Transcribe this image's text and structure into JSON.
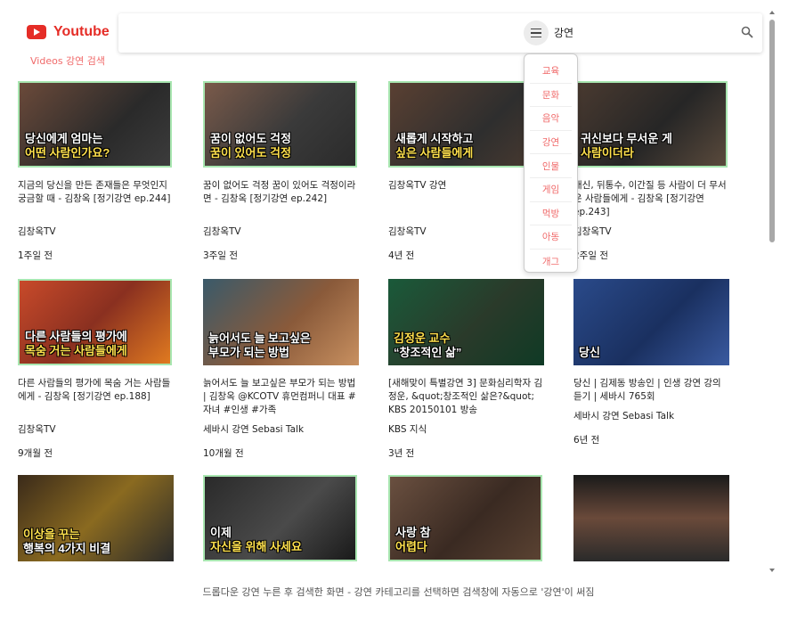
{
  "app": {
    "logo_text": "Youtube",
    "subtitle": "Videos 강연 검색"
  },
  "search": {
    "value": "강연"
  },
  "dropdown": {
    "items": [
      "교육",
      "문화",
      "음악",
      "강연",
      "인물",
      "게임",
      "먹방",
      "아동",
      "개그"
    ]
  },
  "videos": [
    {
      "title": "지금의 당신을 만든 존재들은 무엇인지 궁금할 때 - 김창옥 [정기강연 ep.244]",
      "channel": "김창옥TV",
      "time": "1주일 전",
      "thumb_text_1": "당신에게 엄마는",
      "thumb_text_2": "어떤 사람인가요?"
    },
    {
      "title": "꿈이 없어도 걱정 꿈이 있어도 걱정이라면 - 김창옥 [정기강연 ep.242]",
      "channel": "김창옥TV",
      "time": "3주일 전",
      "thumb_text_1": "꿈이 없어도 걱정",
      "thumb_text_2": "꿈이 있어도 걱정"
    },
    {
      "title": "김창옥TV 강연",
      "channel": "김창옥TV",
      "time": "4년 전",
      "thumb_text_1": "새롭게 시작하고",
      "thumb_text_2": "싶은 사람들에게"
    },
    {
      "title": "배신, 뒤통수, 이간질 등 사람이 더 무서운 사람들에게 - 김창옥 [정기강연 ep.243]",
      "channel": "김창옥TV",
      "time": "2주일 전",
      "thumb_text_1": "귀신보다 무서운 게",
      "thumb_text_2": "사람이더라"
    },
    {
      "title": "다른 사람들의 평가에 목숨 거는 사람들에게 - 김창옥 [정기강연 ep.188]",
      "channel": "김창옥TV",
      "time": "9개월 전",
      "thumb_text_1": "다른 사람들의 평가에",
      "thumb_text_2": "목숨 거는 사람들에게"
    },
    {
      "title": "늙어서도 늘 보고싶은 부모가 되는 방법 | 김창옥 @KCOTV 휴먼컴퍼니 대표 #자녀 #인생 #가족",
      "channel": "세바시 강연 Sebasi Talk",
      "time": "10개월 전",
      "thumb_text_1": "늙어서도 늘 보고싶은",
      "thumb_text_2": "부모가 되는 방법"
    },
    {
      "title": "[새해맞이 특별강연 3] 문화심리학자 김정운, &quot;창조적인 삶은?&quot; KBS 20150101 방송",
      "channel": "KBS 지식",
      "time": "3년 전",
      "thumb_text_1": "김정운 교수",
      "thumb_text_2": "“창조적인 삶”"
    },
    {
      "title": "당신 | 김제동 방송인 | 인생 강연 강의 듣기 | 세바시 765회",
      "channel": "세바시 강연 Sebasi Talk",
      "time": "6년 전",
      "thumb_text_1": "",
      "thumb_text_2": "당신"
    },
    {
      "title": "",
      "channel": "",
      "time": "",
      "thumb_text_1": "이상을 꾸는",
      "thumb_text_2": "행복의 4가지 비결"
    },
    {
      "title": "",
      "channel": "",
      "time": "",
      "thumb_text_1": "이제",
      "thumb_text_2": "자신을 위해 사세요"
    },
    {
      "title": "",
      "channel": "",
      "time": "",
      "thumb_text_1": "사랑 참",
      "thumb_text_2": "어렵다"
    },
    {
      "title": "",
      "channel": "",
      "time": "",
      "thumb_text_1": "",
      "thumb_text_2": ""
    }
  ],
  "caption": "드롭다운 강연 누른 후 검색한 화면 - 강연 카테고리를 선택하면 검색창에 자동으로 '강연'이 써짐",
  "colors": {
    "brand": "#e52d27",
    "accent": "#f06a6a",
    "thumb_border": "#a8e6b0"
  }
}
